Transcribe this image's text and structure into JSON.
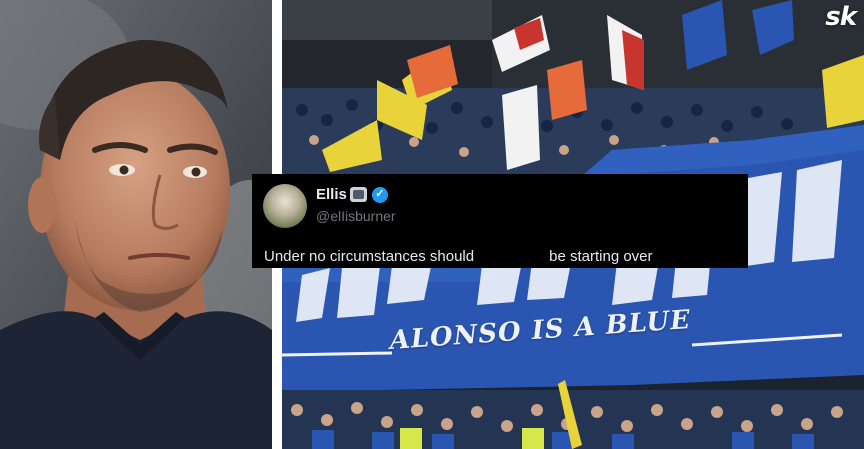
{
  "image": {
    "left_subject": "man-portrait",
    "right_subject": "stadium-crowd-with-flags",
    "brand_logo": "sk",
    "banner": {
      "text": "ALONSO IS A BLUE",
      "color": "#2a55b0"
    }
  },
  "tweet": {
    "display_name": "Ellis",
    "name_emoji_icon": "stadium-emoji-icon",
    "verified_icon": "verified-badge-icon",
    "handle": "@elIisburner",
    "text": "Under no circumstances should                  be starting over"
  },
  "colors": {
    "tweet_bg": "#000000",
    "tweet_text": "#e7e9ea",
    "tweet_handle": "#71767b",
    "verified": "#1d9bf0",
    "chelsea_blue": "#2a55b0"
  }
}
